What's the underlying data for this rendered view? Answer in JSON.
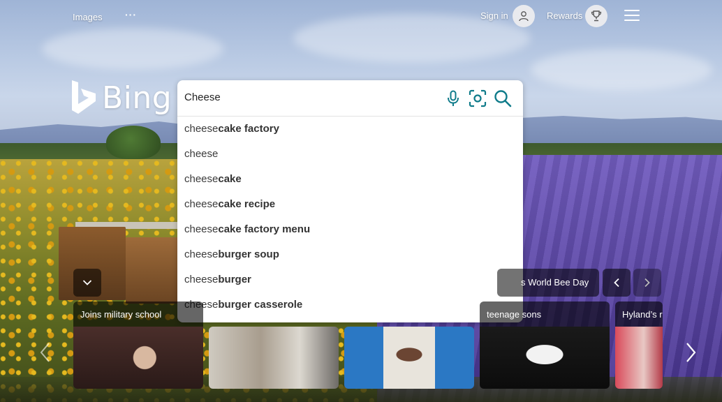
{
  "header": {
    "images_label": "Images",
    "more_label": "···",
    "signin_label": "Sign in",
    "rewards_label": "Rewards"
  },
  "logo": {
    "text": "Bing"
  },
  "search": {
    "value": "Cheese",
    "placeholder": "",
    "suggestions": [
      {
        "prefix": "cheese",
        "completion": "cake factory"
      },
      {
        "prefix": "cheese",
        "completion": ""
      },
      {
        "prefix": "cheese",
        "completion": "cake"
      },
      {
        "prefix": "cheese",
        "completion": "cake recipe"
      },
      {
        "prefix": "cheese",
        "completion": "cake factory menu"
      },
      {
        "prefix": "cheese",
        "completion": "burger soup"
      },
      {
        "prefix": "cheese",
        "completion": "burger"
      },
      {
        "prefix": "cheese",
        "completion": "burger casserole"
      }
    ]
  },
  "carousel": {
    "topic_label": "s World Bee Day",
    "cards": [
      {
        "caption": "Joins military school"
      },
      {
        "caption": ""
      },
      {
        "caption": ""
      },
      {
        "caption": "teenage sons"
      },
      {
        "caption": "Hyland’s r"
      }
    ]
  },
  "colors": {
    "accent": "#0f6cbd",
    "icon_teal": "#0f7b8a",
    "overlay": "#000000"
  },
  "icons": [
    "user-icon",
    "trophy-icon",
    "menu-icon",
    "bing-logo-icon",
    "microphone-icon",
    "visual-search-icon",
    "search-icon",
    "chevron-down-icon",
    "chevron-left-icon",
    "chevron-right-icon"
  ]
}
